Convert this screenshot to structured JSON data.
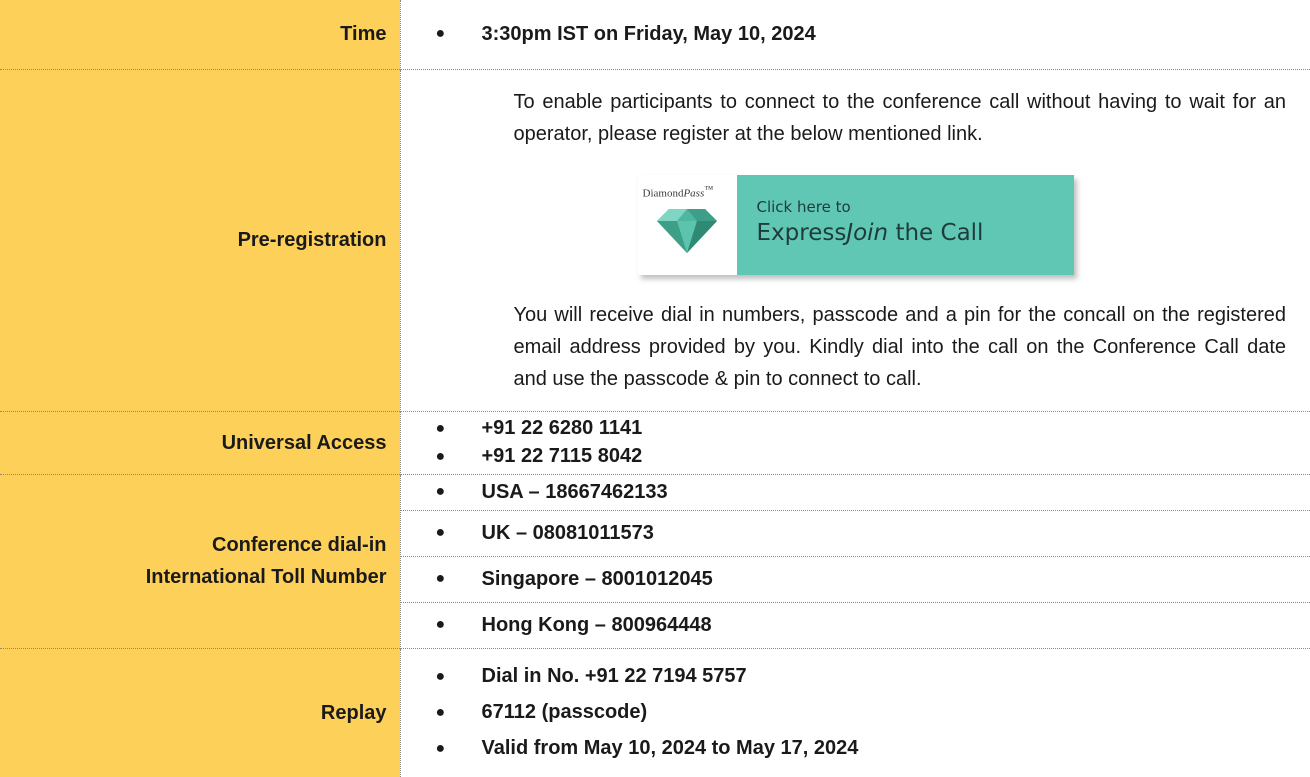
{
  "rows": {
    "time": {
      "label": "Time",
      "items": [
        "3:30pm IST on Friday, May 10, 2024"
      ]
    },
    "preregistration": {
      "label": "Pre-registration",
      "intro": "To enable participants to connect to the conference call without having to wait for an operator, please register at the below mentioned link.",
      "banner": {
        "brand_a": "Diamond",
        "brand_b": "Pass",
        "brand_c": "™",
        "small": "Click here to",
        "big_a": "Express",
        "big_b": "Join",
        "big_c": " the Call"
      },
      "outro": "You will receive dial in numbers, passcode and a pin for the concall on the registered email address provided by you. Kindly dial into the call on the Conference Call date and use the passcode & pin to connect to call."
    },
    "universal": {
      "label": "Universal Access",
      "items": [
        "+91 22 6280 1141",
        "+91 22 7115 8042"
      ]
    },
    "international": {
      "label_line1": "Conference dial-in",
      "label_line2": "International Toll Number",
      "items": [
        "USA – 18667462133",
        "UK – 08081011573",
        "Singapore – 8001012045",
        "Hong Kong – 800964448"
      ]
    },
    "replay": {
      "label": "Replay",
      "items": [
        "Dial in No. +91 22 7194 5757",
        "67112 (passcode)",
        "Valid from May 10, 2024 to May 17, 2024"
      ]
    }
  },
  "bullet_glyph": "●",
  "colors": {
    "label_bg": "#fdd05a",
    "banner_teal": "#5fc7b4"
  }
}
